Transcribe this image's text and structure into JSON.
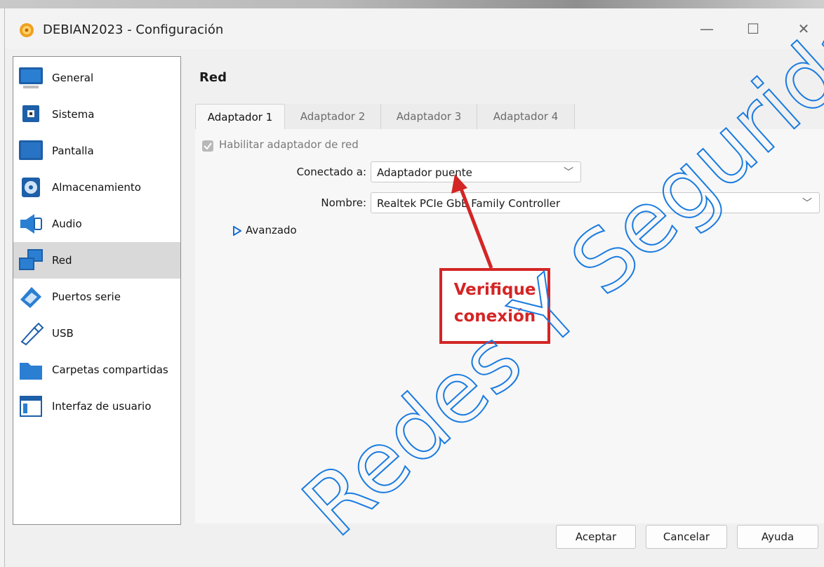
{
  "window": {
    "title": "DEBIAN2023 - Configuración",
    "controls": {
      "minimize": "—",
      "maximize": "☐",
      "close": "✕"
    }
  },
  "sidebar": {
    "items": [
      {
        "label": "General",
        "icon": "general-monitor-icon"
      },
      {
        "label": "Sistema",
        "icon": "chip-icon"
      },
      {
        "label": "Pantalla",
        "icon": "display-icon"
      },
      {
        "label": "Almacenamiento",
        "icon": "storage-disk-icon"
      },
      {
        "label": "Audio",
        "icon": "speaker-icon"
      },
      {
        "label": "Red",
        "icon": "network-icon",
        "selected": true
      },
      {
        "label": "Puertos serie",
        "icon": "serial-port-icon"
      },
      {
        "label": "USB",
        "icon": "usb-icon"
      },
      {
        "label": "Carpetas compartidas",
        "icon": "folder-icon"
      },
      {
        "label": "Interfaz de usuario",
        "icon": "ui-window-icon"
      }
    ]
  },
  "main": {
    "title": "Red",
    "tabs": [
      {
        "label": "Adaptador 1",
        "active": true
      },
      {
        "label": "Adaptador 2"
      },
      {
        "label": "Adaptador 3"
      },
      {
        "label": "Adaptador 4"
      }
    ],
    "enable_label": "Habilitar adaptador de red",
    "connected_label": "Conectado a:",
    "connected_value": "Adaptador puente",
    "name_label": "Nombre:",
    "name_value": "Realtek PCIe GbE Family Controller",
    "advanced_label": "Avanzado"
  },
  "buttons": {
    "accept": "Aceptar",
    "cancel": "Cancelar",
    "help": "Ayuda"
  },
  "annotation": {
    "line1": "Verifique",
    "line2": "conexión",
    "color": "#d42525"
  },
  "watermark": {
    "text": "Redes Y Seguridad -",
    "color": "#1a7be0"
  }
}
